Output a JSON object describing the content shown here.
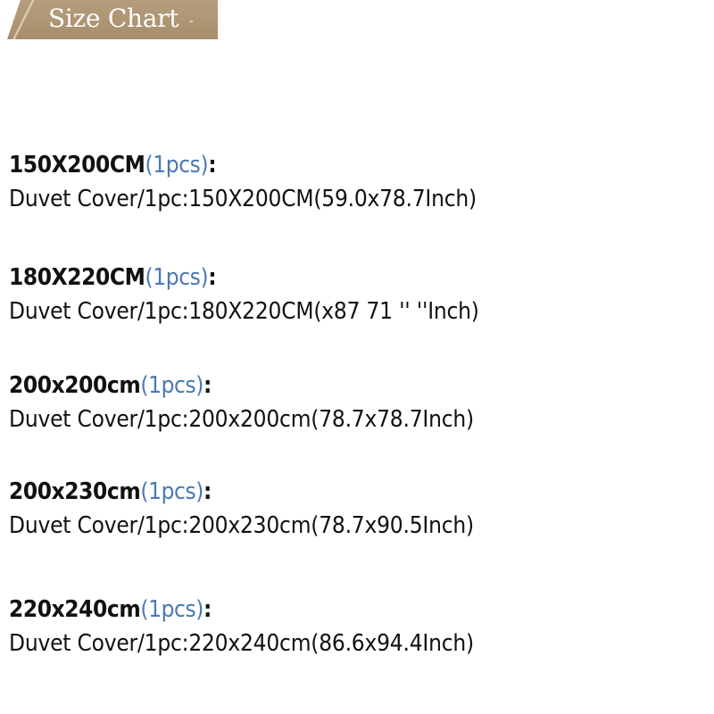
{
  "header": {
    "title": "Size Chart",
    "caret": "-"
  },
  "entries": [
    {
      "size": "150X200CM",
      "qty": "(1pcs)",
      "colon": ":",
      "desc": "Duvet Cover/1pc:150X200CM(59.0x78.7Inch)"
    },
    {
      "size": "180X220CM",
      "qty": "(1pcs)",
      "colon": ":",
      "desc": "Duvet Cover/1pc:180X220CM(x87 71 '' ''Inch)"
    },
    {
      "size": "200x200cm",
      "qty": "(1pcs)",
      "colon": ":",
      "desc": "Duvet Cover/1pc:200x200cm(78.7x78.7Inch)"
    },
    {
      "size": "200x230cm",
      "qty": "(1pcs)",
      "colon": ":",
      "desc": "Duvet Cover/1pc:200x230cm(78.7x90.5Inch)"
    },
    {
      "size": "220x240cm",
      "qty": "(1pcs)",
      "colon": ":",
      "desc": "Duvet Cover/1pc:220x240cm(86.6x94.4Inch)"
    }
  ],
  "colors": {
    "header_bg": "#a88e6b",
    "qty_text": "#4a79b5",
    "body_text": "#111111"
  }
}
